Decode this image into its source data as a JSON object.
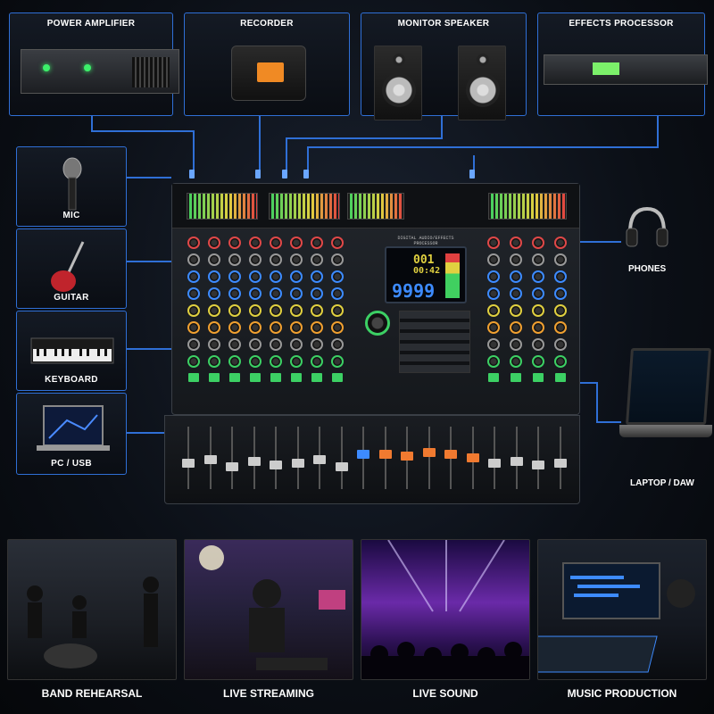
{
  "devices": {
    "top": [
      {
        "label": "POWER AMPLIFIER",
        "icon": "power-amplifier-icon"
      },
      {
        "label": "RECORDER",
        "icon": "recorder-icon"
      },
      {
        "label": "MONITOR SPEAKER",
        "icon": "monitor-speaker-icon"
      },
      {
        "label": "EFFECTS PROCESSOR",
        "icon": "effects-processor-icon"
      }
    ],
    "left": [
      {
        "label": "MIC",
        "icon": "mic-icon"
      },
      {
        "label": "GUITAR",
        "icon": "guitar-icon"
      },
      {
        "label": "KEYBOARD",
        "icon": "keyboard-icon"
      },
      {
        "label": "PC / USB",
        "icon": "pc-usb-icon"
      }
    ],
    "right": [
      {
        "label": "PHONES",
        "icon": "headphones-icon"
      },
      {
        "label": "LAPTOP / DAW",
        "icon": "laptop-icon"
      }
    ]
  },
  "mixer": {
    "dsp_title": "DIGITAL AUDIO/EFFECTS PROCESSOR",
    "display": {
      "row1": "001",
      "row2": "00:42",
      "main": "9999"
    },
    "accent_colors": {
      "wire": "#2f6fd6",
      "mute": "#3cd064"
    }
  },
  "scenes": [
    {
      "label": "BAND REHEARSAL"
    },
    {
      "label": "LIVE STREAMING"
    },
    {
      "label": "LIVE SOUND"
    },
    {
      "label": "MUSIC PRODUCTION"
    }
  ]
}
